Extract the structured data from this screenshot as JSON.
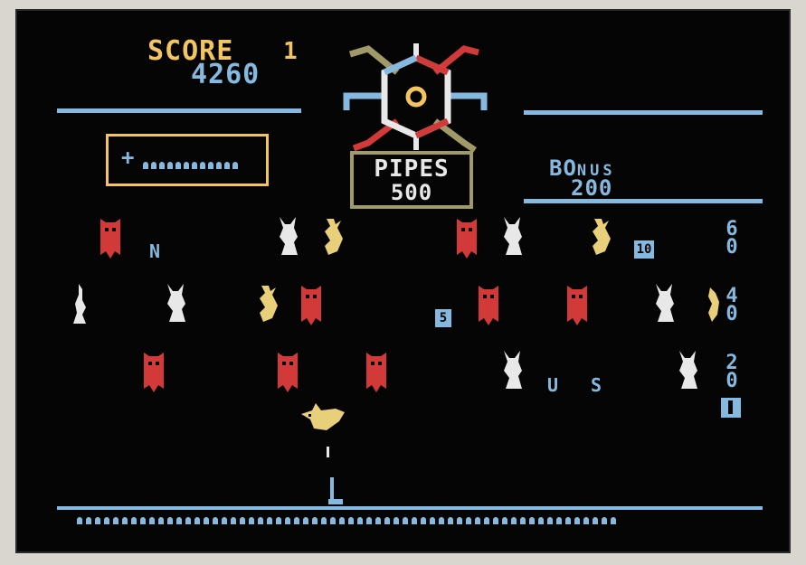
{
  "score": {
    "label": "SCORE",
    "player": "1",
    "value": "4260"
  },
  "pipes": {
    "label": "PIPES",
    "value": "500"
  },
  "bonus": {
    "label_big": "BO",
    "label_small": "NUS",
    "value": "200"
  },
  "ammo_box": {
    "symbol": "+"
  },
  "row_values": [
    "6\n0",
    "4\n0",
    "2\n0"
  ],
  "letters": [
    "N",
    "U",
    "S"
  ],
  "box_numbers": [
    "10",
    "5"
  ],
  "colors": {
    "background": "#050505",
    "accent_blue": "#86b9df",
    "score_yellow": "#f2c560",
    "owl_red": "#d23a3a",
    "rabbit_white": "#e8e8e8",
    "duck_yellow": "#e8cf7a",
    "pipes_frame": "#a09a68"
  },
  "icons": [
    "owl-icon",
    "rabbit-icon",
    "duck-icon",
    "gun-icon",
    "pipe-wheel-icon"
  ]
}
